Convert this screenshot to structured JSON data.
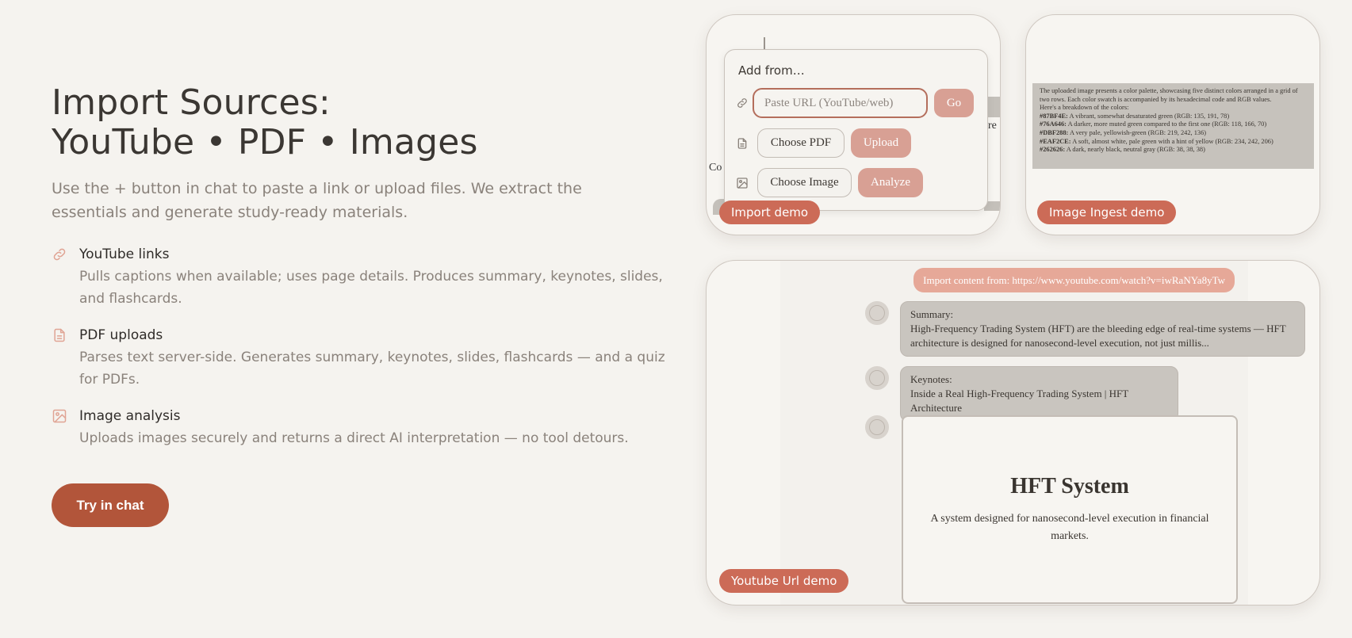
{
  "hero": {
    "title_line1": "Import Sources:",
    "title_line2": "YouTube • PDF • Images",
    "subtitle": "Use the + button in chat to paste a link or upload files. We extract the essentials and generate study-ready materials."
  },
  "features": [
    {
      "icon": "link-icon",
      "title": "YouTube links",
      "desc": "Pulls captions when available; uses page details. Produces summary, keynotes, slides, and flashcards."
    },
    {
      "icon": "document-icon",
      "title": "PDF uploads",
      "desc": "Parses text server-side. Generates summary, keynotes, slides, flashcards — and a quiz for PDFs."
    },
    {
      "icon": "image-icon",
      "title": "Image analysis",
      "desc": "Uploads images securely and returns a direct AI interpretation — no tool detours."
    }
  ],
  "cta": {
    "label": "Try in chat"
  },
  "import_demo": {
    "pill": "Import demo",
    "add_title": "Add from…",
    "url_placeholder": "Paste URL (YouTube/web)",
    "go_label": "Go",
    "choose_pdf": "Choose PDF",
    "upload_label": "Upload",
    "choose_image": "Choose Image",
    "analyze_label": "Analyze",
    "bg_fragment_1": "Co",
    "bg_fragment_2": "gre"
  },
  "image_demo": {
    "pill": "Image Ingest demo",
    "intro": "The uploaded image presents a color palette, showcasing five distinct colors arranged in a grid of two rows. Each color swatch is accompanied by its hexadecimal code and RGB values.",
    "breakdown_label": "Here's a breakdown of the colors:",
    "colors": [
      {
        "hex": "#87BF4E:",
        "desc": "A vibrant, somewhat desaturated green (RGB: 135, 191, 78)"
      },
      {
        "hex": "#76A646:",
        "desc": "A darker, more muted green compared to the first one (RGB: 118, 166, 70)"
      },
      {
        "hex": "#DBF288:",
        "desc": "A very pale, yellowish-green (RGB: 219, 242, 136)"
      },
      {
        "hex": "#EAF2CE:",
        "desc": "A soft, almost white, pale green with a hint of yellow (RGB: 234, 242, 206)"
      },
      {
        "hex": "#262626:",
        "desc": "A dark, nearly black, neutral gray (RGB: 38, 38, 38)"
      }
    ]
  },
  "youtube_demo": {
    "pill": "Youtube Url demo",
    "user_message": "Import content from: https://www.youtube.com/watch?v=iwRaNYa8yTw",
    "summary_label": "Summary:",
    "summary_text": "High-Frequency Trading System (HFT) are the bleeding edge of real-time systems — HFT architecture is designed for nanosecond-level execution, not just millis...",
    "keynotes_label": "Keynotes:",
    "keynotes_text": "Inside a Real High-Frequency Trading System | HFT Architecture",
    "slide_title": "HFT System",
    "slide_desc": "A system designed for nanosecond-level execution in financial markets."
  },
  "colors": {
    "background": "#f5f3ef",
    "accent": "#b2553a",
    "pill": "#cc6b57",
    "soft_button": "#d8a094",
    "icon": "#e0a494"
  }
}
